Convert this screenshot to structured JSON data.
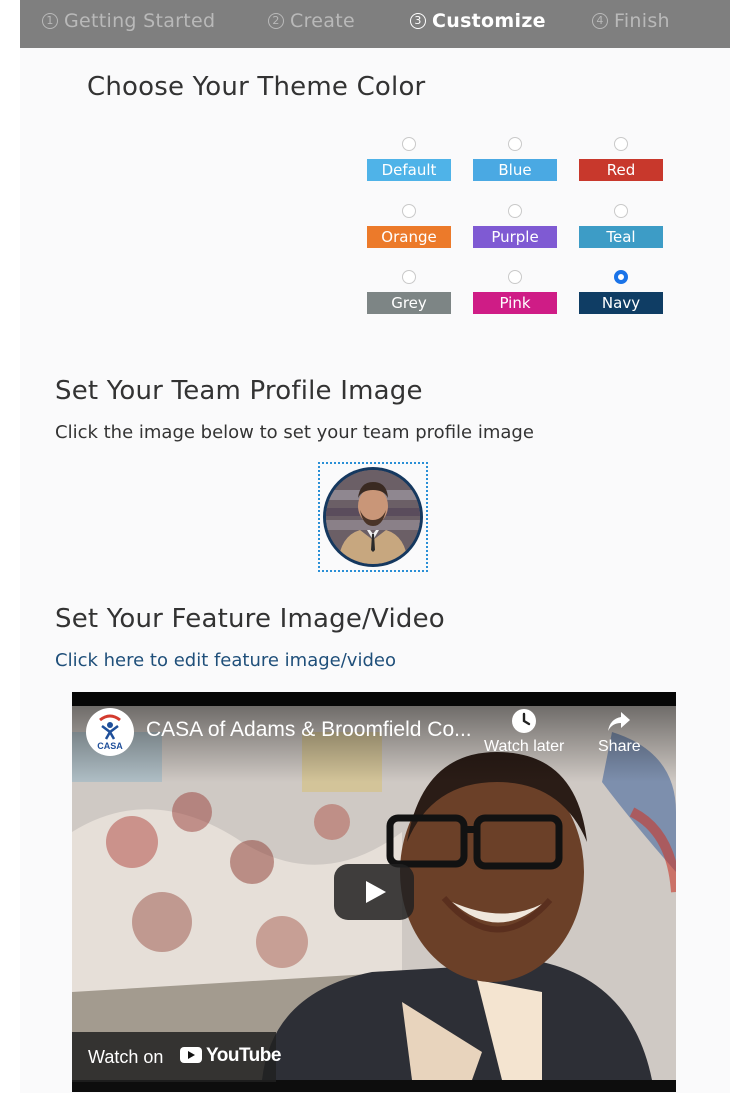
{
  "stepper": {
    "steps": [
      {
        "num": "1",
        "label": "Getting Started"
      },
      {
        "num": "2",
        "label": "Create"
      },
      {
        "num": "3",
        "label": "Customize"
      },
      {
        "num": "4",
        "label": "Finish"
      }
    ]
  },
  "theme": {
    "title": "Choose Your Theme Color",
    "selected": "Navy",
    "options": [
      {
        "label": "Default",
        "color": "#4fb3e8"
      },
      {
        "label": "Blue",
        "color": "#4aa9e3"
      },
      {
        "label": "Red",
        "color": "#c8382c"
      },
      {
        "label": "Orange",
        "color": "#ec7a2a"
      },
      {
        "label": "Purple",
        "color": "#7f5ad3"
      },
      {
        "label": "Teal",
        "color": "#3d9cc6"
      },
      {
        "label": "Grey",
        "color": "#7d8585"
      },
      {
        "label": "Pink",
        "color": "#cf1c86"
      },
      {
        "label": "Navy",
        "color": "#0f3d64"
      }
    ]
  },
  "profile": {
    "title": "Set Your Team Profile Image",
    "description": "Click the image below to set your team profile image"
  },
  "feature": {
    "title": "Set Your Feature Image/Video",
    "edit_link": "Click here to edit feature image/video"
  },
  "video": {
    "title": "CASA of Adams & Broomfield Co...",
    "channel_logo_text": "CASA",
    "watch_later": "Watch later",
    "share": "Share",
    "watch_on": "Watch on",
    "youtube": "YouTube"
  },
  "colors": {
    "stepper_bg": "#7f7f7f",
    "link": "#1f4f7a",
    "avatar_ring": "#15385f",
    "selection_outline": "#2a8fd6"
  }
}
